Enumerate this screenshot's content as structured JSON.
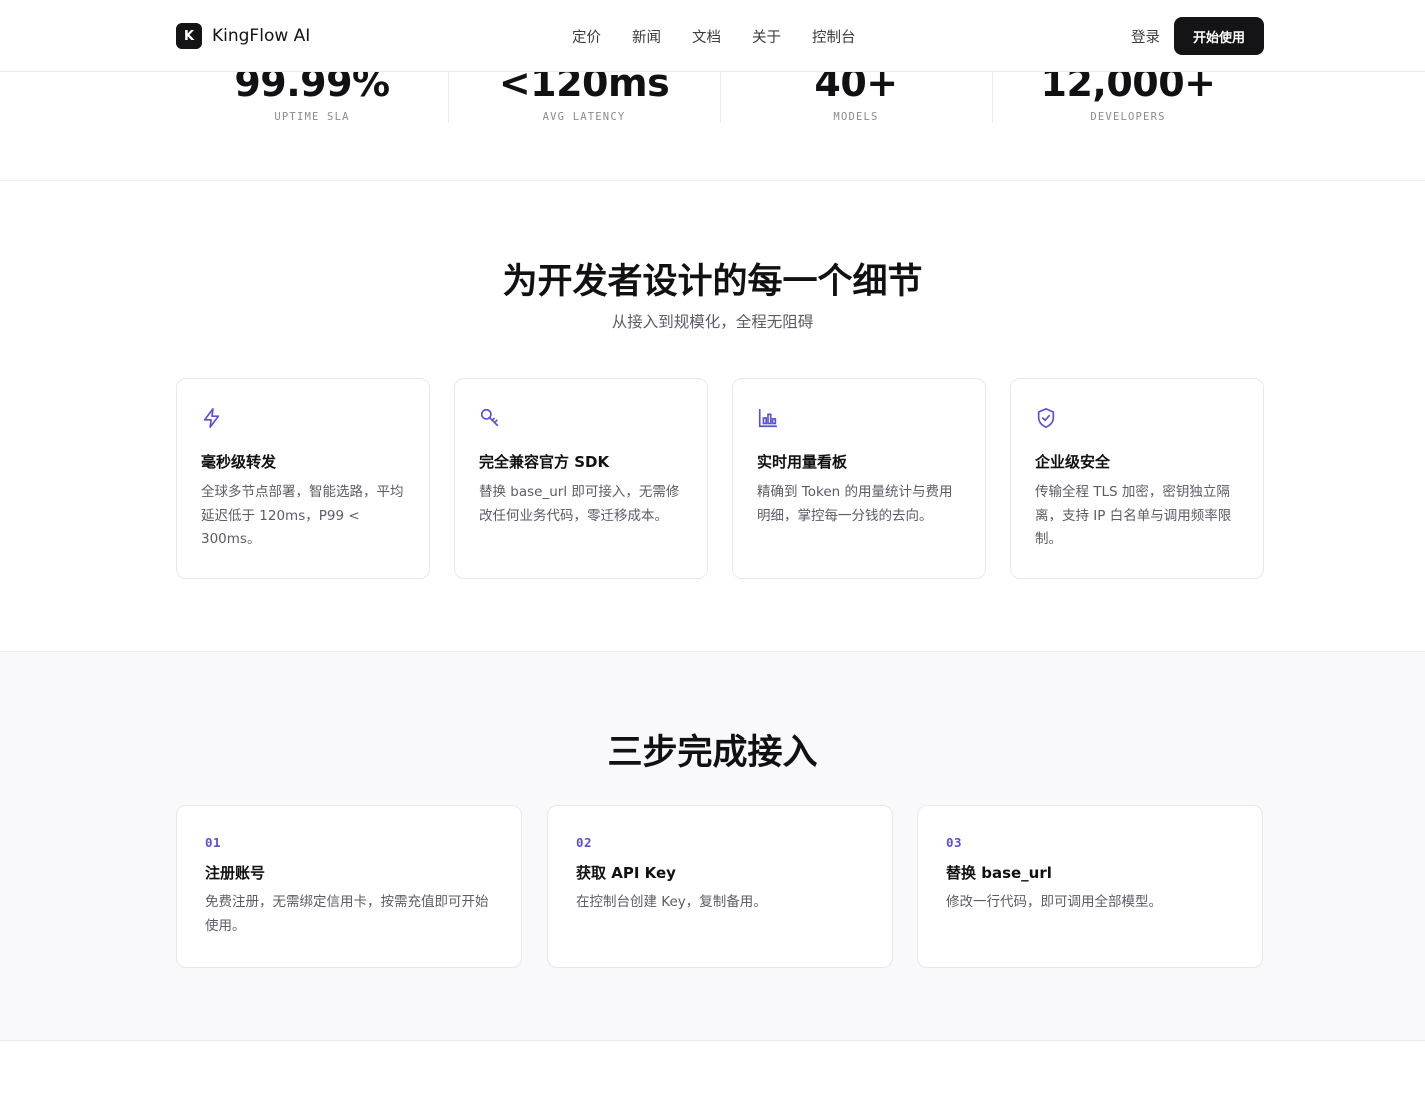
{
  "header": {
    "brand_mark": "K",
    "brand_name": "KingFlow AI",
    "nav": [
      "定价",
      "新闻",
      "文档",
      "关于",
      "控制台"
    ],
    "login": "登录",
    "cta": "开始使用"
  },
  "stats": [
    {
      "value": "99.99%",
      "label": "UPTIME SLA"
    },
    {
      "value": "<120ms",
      "label": "AVG LATENCY"
    },
    {
      "value": "40+",
      "label": "MODELS"
    },
    {
      "value": "12,000+",
      "label": "DEVELOPERS"
    }
  ],
  "features": {
    "title": "为开发者设计的每一个细节",
    "subtitle": "从接入到规模化，全程无阻碍",
    "items": [
      {
        "icon": "lightning-icon",
        "title": "毫秒级转发",
        "desc": "全球多节点部署，智能选路，平均延迟低于 120ms，P99 < 300ms。"
      },
      {
        "icon": "key-icon",
        "title": "完全兼容官方 SDK",
        "desc": "替换 base_url 即可接入，无需修改任何业务代码，零迁移成本。"
      },
      {
        "icon": "bar-chart-icon",
        "title": "实时用量看板",
        "desc": "精确到 Token 的用量统计与费用明细，掌控每一分钱的去向。"
      },
      {
        "icon": "shield-check-icon",
        "title": "企业级安全",
        "desc": "传输全程 TLS 加密，密钥独立隔离，支持 IP 白名单与调用频率限制。"
      }
    ]
  },
  "steps": {
    "title": "三步完成接入",
    "items": [
      {
        "num": "01",
        "title": "注册账号",
        "desc": "免费注册，无需绑定信用卡，按需充值即可开始使用。"
      },
      {
        "num": "02",
        "title": "获取 API Key",
        "desc": "在控制台创建 Key，复制备用。"
      },
      {
        "num": "03",
        "title": "替换 base_url",
        "desc": "修改一行代码，即可调用全部模型。"
      }
    ]
  },
  "colors": {
    "accent": "#5b4fd6",
    "dark": "#141416",
    "muted_text": "#5c5c66",
    "band_bg": "#f9f9fb"
  }
}
